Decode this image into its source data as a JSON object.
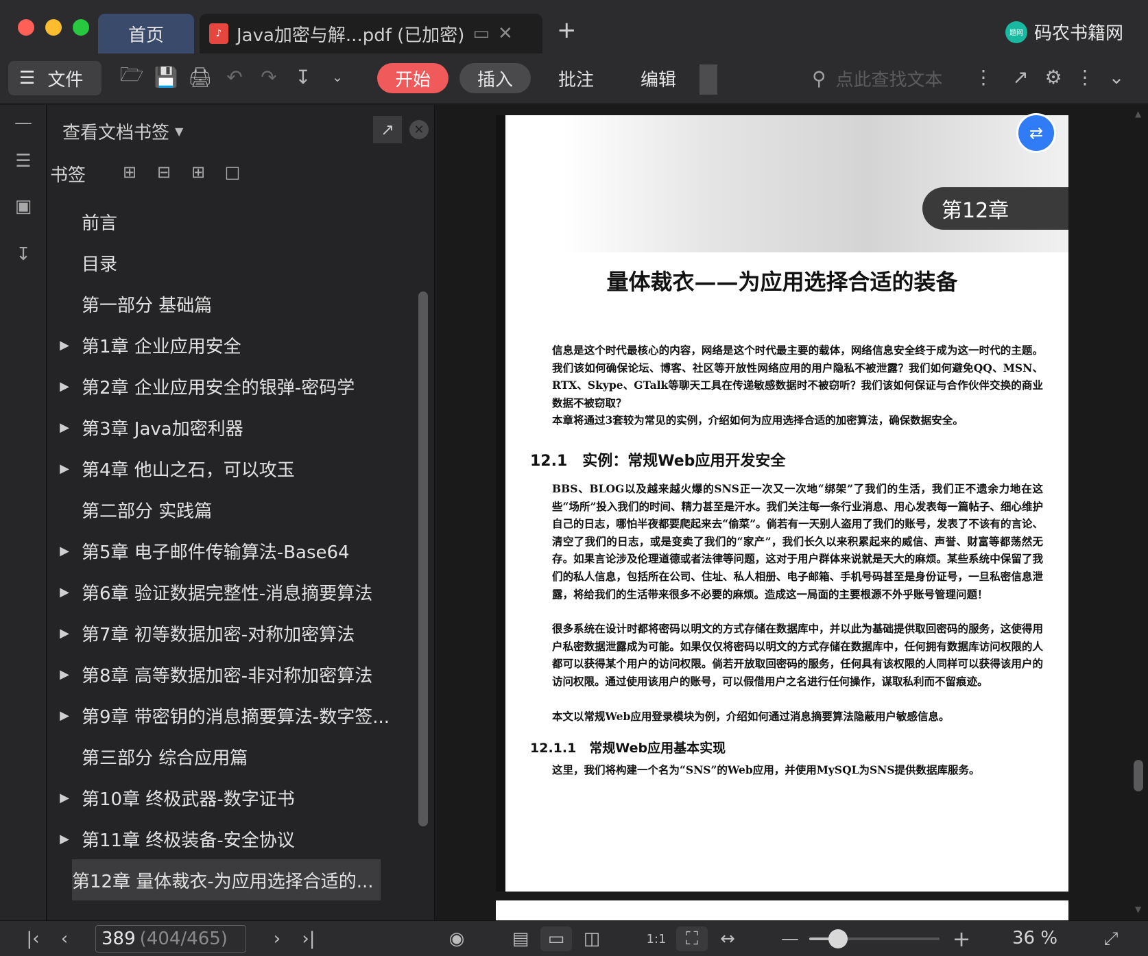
{
  "window": {
    "tabs": [
      {
        "label": "首页"
      },
      {
        "label": "Java加密与解...pdf (已加密)"
      }
    ],
    "brand": "码农书籍网",
    "brand_logo": "题网"
  },
  "toolbar": {
    "file_label": "文件",
    "ribbon": [
      "开始",
      "插入",
      "批注",
      "编辑"
    ],
    "search_placeholder": "点此查找文本"
  },
  "panel": {
    "title": "查看文档书签",
    "bookmarks_label": "书签",
    "items": [
      {
        "label": "前言",
        "expandable": false
      },
      {
        "label": "目录",
        "expandable": false
      },
      {
        "label": "第一部分 基础篇",
        "expandable": false
      },
      {
        "label": "第1章 企业应用安全",
        "expandable": true
      },
      {
        "label": "第2章 企业应用安全的银弹-密码学",
        "expandable": true
      },
      {
        "label": "第3章 Java加密利器",
        "expandable": true
      },
      {
        "label": "第4章 他山之石，可以攻玉",
        "expandable": true
      },
      {
        "label": "第二部分 实践篇",
        "expandable": false
      },
      {
        "label": "第5章 电子邮件传输算法-Base64",
        "expandable": true
      },
      {
        "label": "第6章 验证数据完整性-消息摘要算法",
        "expandable": true
      },
      {
        "label": "第7章 初等数据加密-对称加密算法",
        "expandable": true
      },
      {
        "label": "第8章 高等数据加密-非对称加密算法",
        "expandable": true
      },
      {
        "label": "第9章 带密钥的消息摘要算法-数字签...",
        "expandable": true
      },
      {
        "label": "第三部分 综合应用篇",
        "expandable": false
      },
      {
        "label": "第10章 终极武器-数字证书",
        "expandable": true
      },
      {
        "label": "第11章 终极装备-安全协议",
        "expandable": true
      },
      {
        "label": "第12章 量体裁衣-为应用选择合适的...",
        "expandable": true,
        "selected": true
      }
    ]
  },
  "document": {
    "chapter_badge": "第12章",
    "title": "量体裁衣——为应用选择合适的装备",
    "intro_p1": "信息是这个时代最核心的内容，网络是这个时代最主要的载体，网络信息安全终于成为这一时代的主题。我们该如何确保论坛、博客、社区等开放性网络应用的用户隐私不被泄露？我们如何避免QQ、MSN、RTX、Skype、GTalk等聊天工具在传递敏感数据时不被窃听？我们该如何保证与合作伙伴交换的商业数据不被窃取？",
    "intro_p2": "本章将通过3套较为常见的实例，介绍如何为应用选择合适的加密算法，确保数据安全。",
    "section_12_1": "12.1　实例：常规Web应用开发安全",
    "s1_p1": "BBS、BLOG以及越来越火爆的SNS正一次又一次地“绑架”了我们的生活，我们正不遗余力地在这些“场所”投入我们的时间、精力甚至是汗水。我们关注每一条行业消息、用心发表每一篇帖子、细心维护自己的日志，哪怕半夜都要爬起来去“偷菜”。倘若有一天别人盗用了我们的账号，发表了不该有的言论、清空了我们的日志，或是变卖了我们的“家产”，我们长久以来积累起来的威信、声誉、财富等都荡然无存。如果言论涉及伦理道德或者法律等问题，这对于用户群体来说就是天大的麻烦。某些系统中保留了我们的私人信息，包括所在公司、住址、私人相册、电子邮箱、手机号码甚至是身份证号，一旦私密信息泄露，将给我们的生活带来很多不必要的麻烦。造成这一局面的主要根源不外乎账号管理问题！",
    "s1_p2": "很多系统在设计时都将密码以明文的方式存储在数据库中，并以此为基础提供取回密码的服务，这使得用户私密数据泄露成为可能。如果仅仅将密码以明文的方式存储在数据库中，任何拥有数据库访问权限的人都可以获得某个用户的访问权限。倘若开放取回密码的服务，任何具有该权限的人同样可以获得该用户的访问权限。通过使用该用户的账号，可以假借用户之名进行任何操作，谋取私利而不留痕迹。",
    "s1_p3": "本文以常规Web应用登录模块为例，介绍如何通过消息摘要算法隐蔽用户敏感信息。",
    "section_12_1_1": "12.1.1　常规Web应用基本实现",
    "s2_p1": "这里，我们将构建一个名为“SNS”的Web应用，并使用MySQL为SNS提供数据库服务。"
  },
  "status": {
    "page_current": "389",
    "page_total": "(404/465)",
    "zoom_label": "36 %",
    "zoom_fraction": 0.22
  }
}
